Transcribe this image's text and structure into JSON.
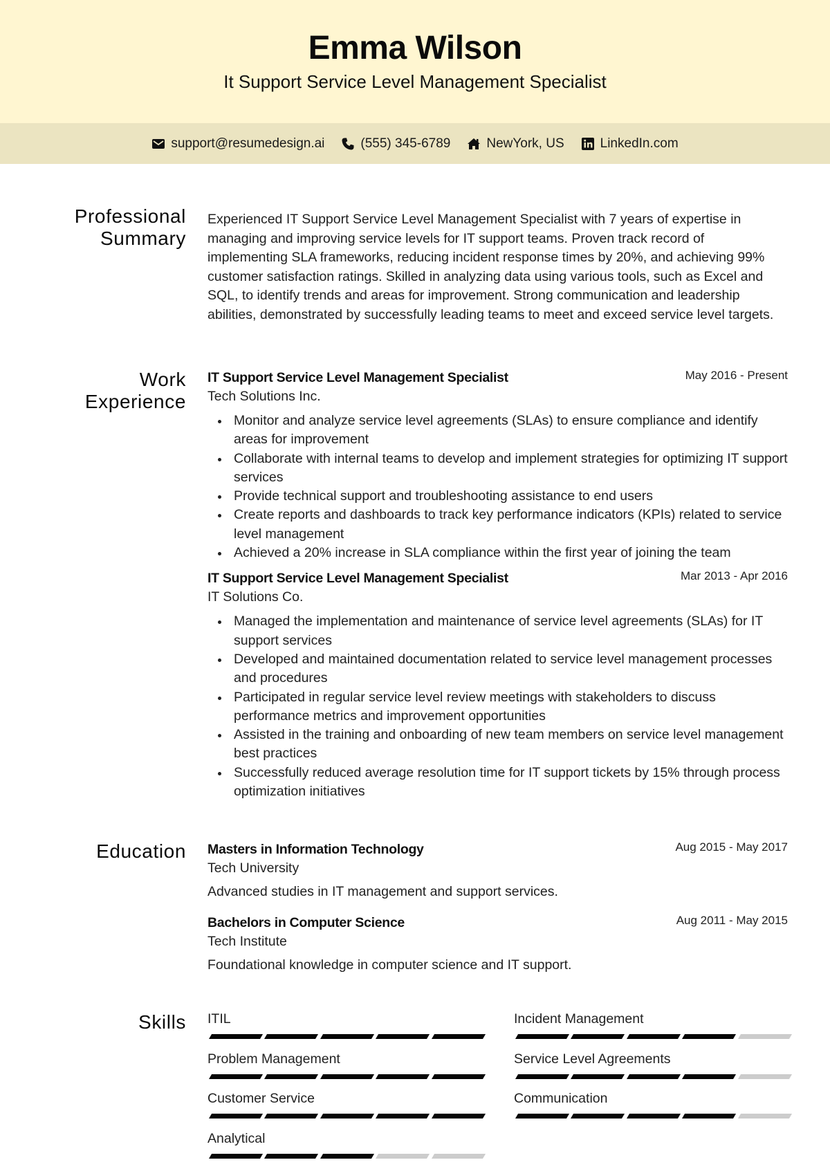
{
  "header": {
    "name": "Emma Wilson",
    "title": "It Support Service Level Management Specialist",
    "colors": {
      "header_bg": "#FFF6D1",
      "contact_bg": "#EBE4C1"
    }
  },
  "contact": [
    {
      "icon": "envelope-icon",
      "text": "support@resumedesign.ai"
    },
    {
      "icon": "phone-icon",
      "text": "(555) 345-6789"
    },
    {
      "icon": "home-icon",
      "text": "NewYork, US"
    },
    {
      "icon": "linkedin-icon",
      "text": "LinkedIn.com"
    }
  ],
  "summary": {
    "heading_line1": "Professional",
    "heading_line2": "Summary",
    "text": "Experienced IT Support Service Level Management Specialist with 7 years of expertise in managing and improving service levels for IT support teams. Proven track record of implementing SLA frameworks, reducing incident response times by 20%, and achieving 99% customer satisfaction ratings. Skilled in analyzing data using various tools, such as Excel and SQL, to identify trends and areas for improvement. Strong communication and leadership abilities, demonstrated by successfully leading teams to meet and exceed service level targets."
  },
  "experience": {
    "heading_line1": "Work",
    "heading_line2": "Experience",
    "jobs": [
      {
        "title": "IT Support Service Level Management Specialist",
        "company": "Tech Solutions Inc.",
        "dates": "May 2016 - Present",
        "bullets": [
          "Monitor and analyze service level agreements (SLAs) to ensure compliance and identify areas for improvement",
          "Collaborate with internal teams to develop and implement strategies for optimizing IT support services",
          "Provide technical support and troubleshooting assistance to end users",
          "Create reports and dashboards to track key performance indicators (KPIs) related to service level management",
          "Achieved a 20% increase in SLA compliance within the first year of joining the team"
        ]
      },
      {
        "title": "IT Support Service Level Management Specialist",
        "company": "IT Solutions Co.",
        "dates": "Mar 2013 - Apr 2016",
        "bullets": [
          "Managed the implementation and maintenance of service level agreements (SLAs) for IT support services",
          "Developed and maintained documentation related to service level management processes and procedures",
          "Participated in regular service level review meetings with stakeholders to discuss performance metrics and improvement opportunities",
          "Assisted in the training and onboarding of new team members on service level management best practices",
          "Successfully reduced average resolution time for IT support tickets by 15% through process optimization initiatives"
        ]
      }
    ]
  },
  "education": {
    "heading": "Education",
    "items": [
      {
        "degree": "Masters in Information Technology",
        "school": "Tech University",
        "dates": "Aug 2015 - May 2017",
        "description": "Advanced studies in IT management and support services."
      },
      {
        "degree": "Bachelors in Computer Science",
        "school": "Tech Institute",
        "dates": "Aug 2011 - May 2015",
        "description": "Foundational knowledge in computer science and IT support."
      }
    ]
  },
  "skills": {
    "heading": "Skills",
    "max_level": 5,
    "items": [
      {
        "name": "ITIL",
        "level": 5
      },
      {
        "name": "Incident Management",
        "level": 4
      },
      {
        "name": "Problem Management",
        "level": 5
      },
      {
        "name": "Service Level Agreements",
        "level": 4
      },
      {
        "name": "Customer Service",
        "level": 5
      },
      {
        "name": "Communication",
        "level": 4
      },
      {
        "name": "Analytical",
        "level": 3
      }
    ]
  }
}
